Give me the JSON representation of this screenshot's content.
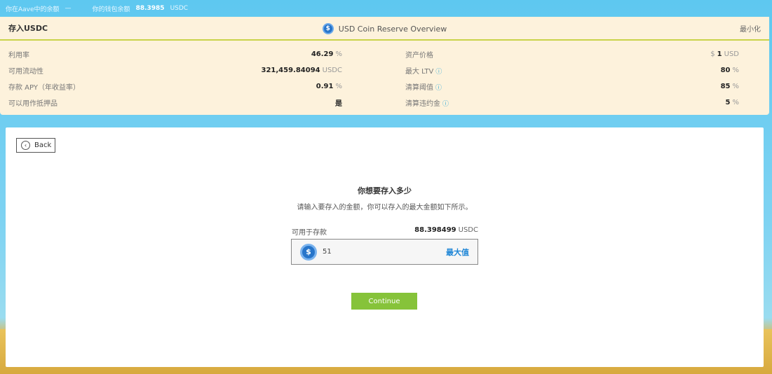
{
  "topbar": {
    "aave_balance_label": "你在Aave中的余额",
    "aave_balance_value": "—",
    "wallet_balance_label": "你的钱包余额",
    "wallet_balance_value": "88.3985",
    "wallet_balance_unit": "USDC"
  },
  "panel": {
    "title": "存入USDC",
    "overview_title": "USD Coin Reserve Overview",
    "coin_icon": "usdc-coin-icon",
    "minimize_label": "最小化",
    "left_stats": [
      {
        "label": "利用率",
        "value": "46.29",
        "unit": "%"
      },
      {
        "label": "可用流动性",
        "value": "321,459.84094",
        "unit": "USDC"
      },
      {
        "label": "存款 APY（年收益率）",
        "value": "0.91",
        "unit": "%"
      },
      {
        "label": "可以用作抵押品",
        "value": "是",
        "unit": ""
      }
    ],
    "right_stats": [
      {
        "label": "资产价格",
        "prefix": "$",
        "value": "1",
        "unit": "USD"
      },
      {
        "label": "最大 LTV",
        "value": "80",
        "unit": "%"
      },
      {
        "label": "清算阈值",
        "value": "85",
        "unit": "%"
      },
      {
        "label": "清算违约金",
        "value": "5",
        "unit": "%"
      }
    ]
  },
  "card": {
    "back_label": "Back",
    "heading": "你想要存入多少",
    "subtext": "请输入要存入的金额，你可以存入的最大金额如下所示。",
    "available_label": "可用于存款",
    "available_value": "88.398499",
    "available_unit": "USDC",
    "amount_value": "51",
    "max_label": "最大值",
    "continue_label": "Continue"
  },
  "colors": {
    "accent_green": "#86c33a",
    "usdc_blue": "#2775ca",
    "panel_bg": "#fdf2dc",
    "sky": "#5ec8f0"
  }
}
